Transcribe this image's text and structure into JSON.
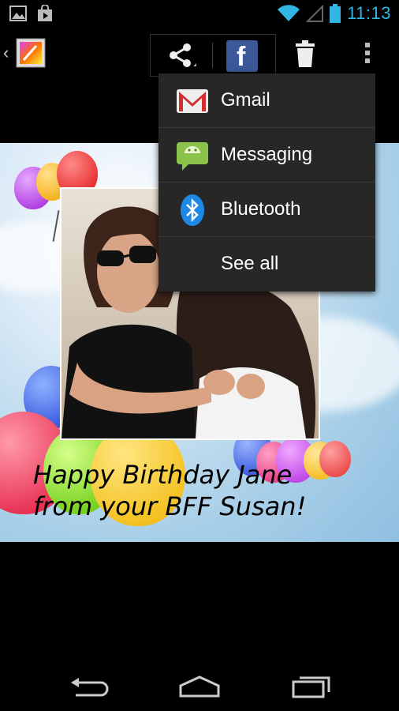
{
  "status_bar": {
    "time": "11:13"
  },
  "action_bar": {
    "share_label": "Share",
    "facebook_glyph": "f"
  },
  "share_menu": {
    "items": [
      {
        "label": "Gmail",
        "icon": "gmail-icon"
      },
      {
        "label": "Messaging",
        "icon": "messaging-icon"
      },
      {
        "label": "Bluetooth",
        "icon": "bluetooth-icon"
      },
      {
        "label": "See all",
        "icon": ""
      }
    ]
  },
  "image": {
    "caption_line1": "Happy Birthday Jane",
    "caption_line2": "from your BFF Susan!"
  },
  "colors": {
    "accent": "#33b5e5",
    "facebook": "#3b5998",
    "menu_bg": "#272727"
  }
}
